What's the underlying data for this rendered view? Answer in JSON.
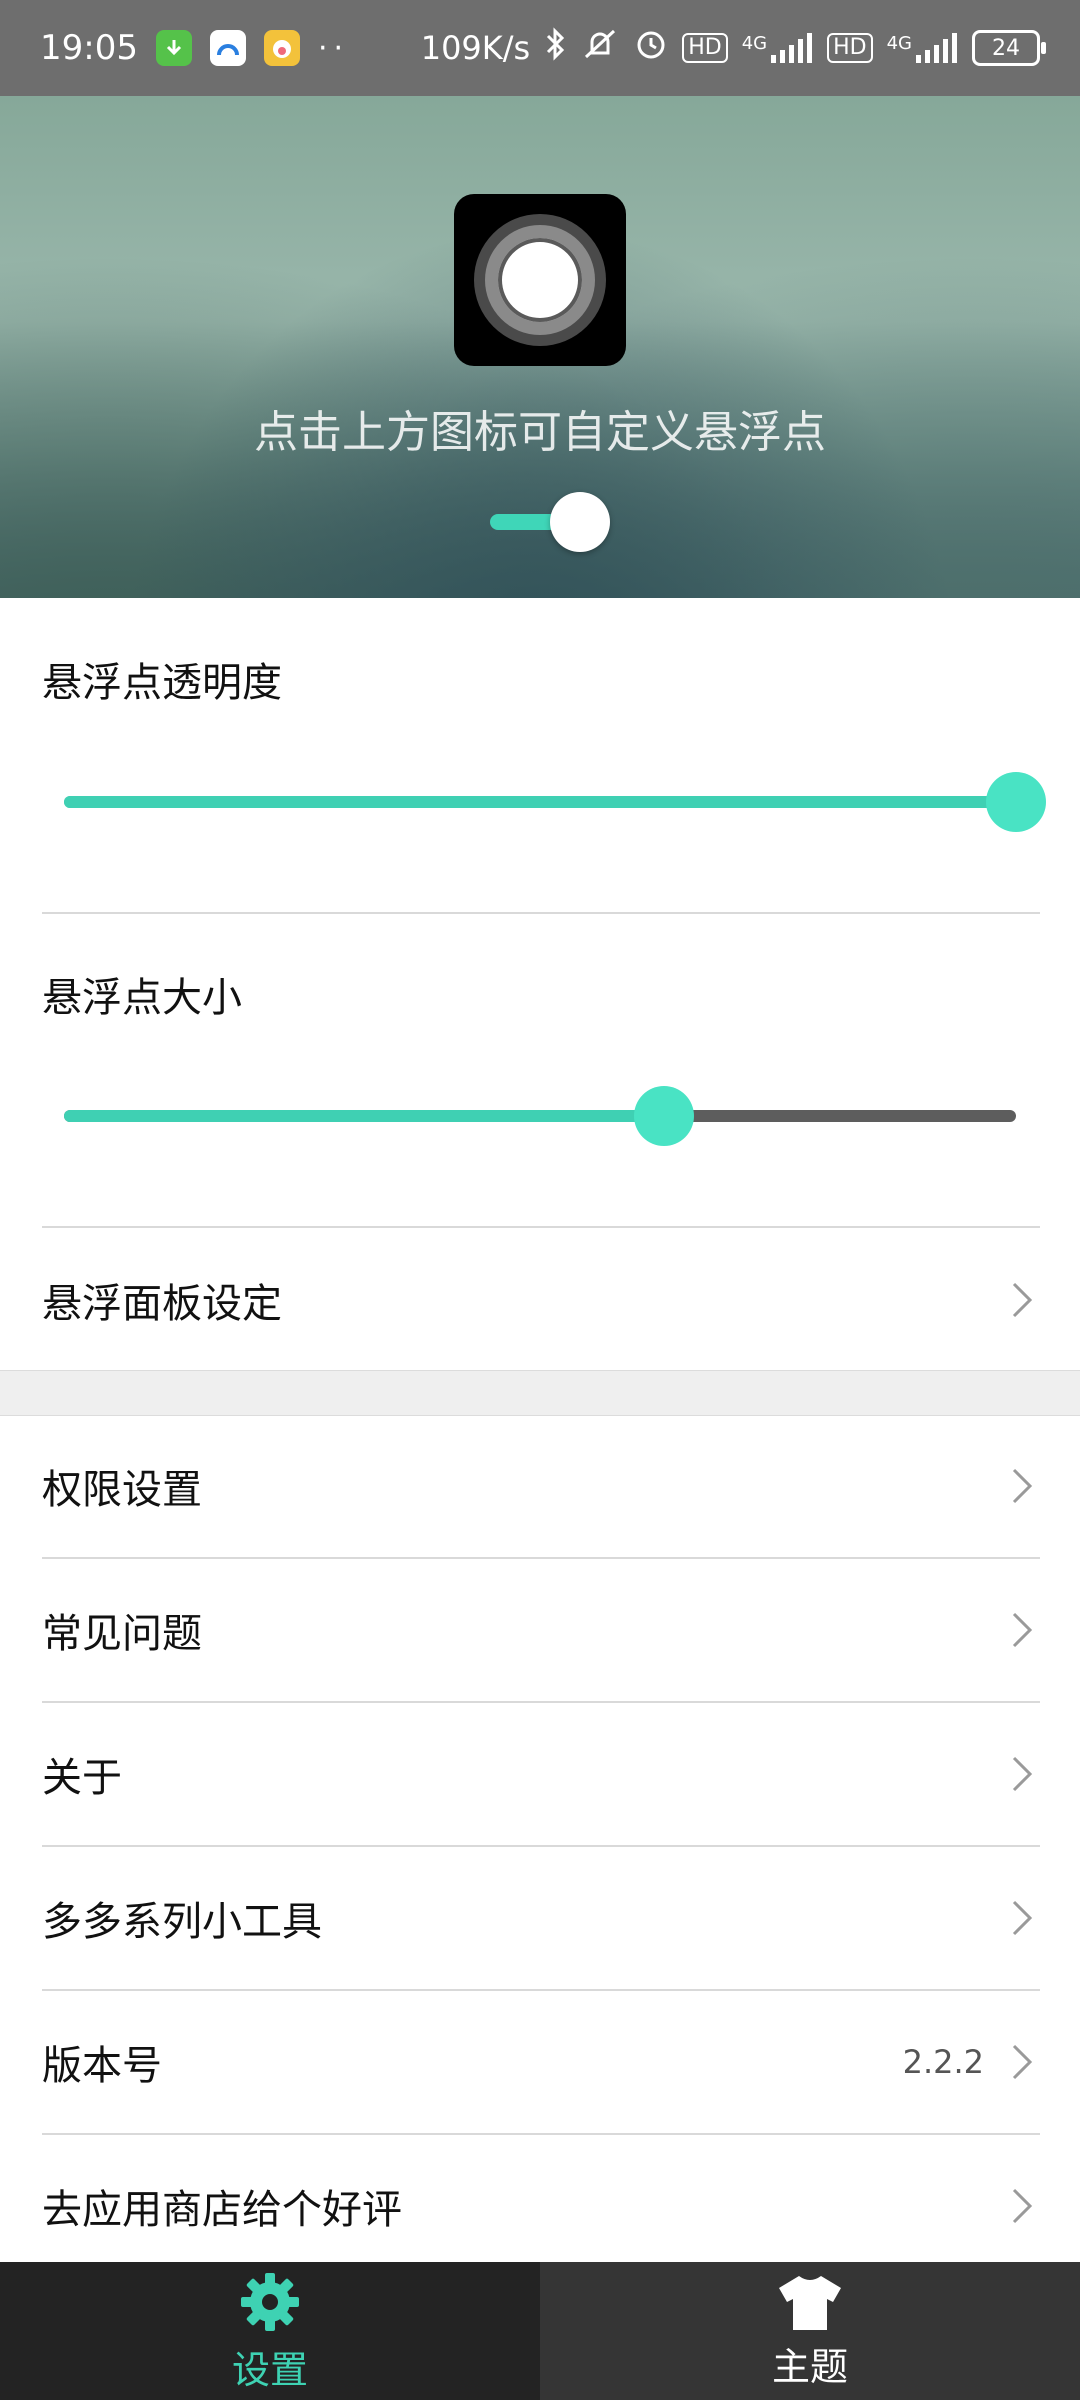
{
  "status_bar": {
    "time": "19:05",
    "dots": "··",
    "net_speed": "109K/s",
    "hd1": "HD",
    "net1": "4G",
    "hd2": "HD",
    "net2": "4G",
    "battery": "24"
  },
  "header": {
    "hint": "点击上方图标可自定义悬浮点",
    "float_toggle_on": true
  },
  "opacity": {
    "title": "悬浮点透明度",
    "value_fraction": 1.0
  },
  "size": {
    "title": "悬浮点大小",
    "value_fraction": 0.63
  },
  "rows": {
    "panel_settings": "悬浮面板设定",
    "permissions": "权限设置",
    "faq": "常见问题",
    "about": "关于",
    "tools": "多多系列小工具",
    "version_label": "版本号",
    "version_value": "2.2.2",
    "rate": "去应用商店给个好评"
  },
  "bottom_nav": {
    "settings": "设置",
    "theme": "主题"
  },
  "colors": {
    "accent": "#3ed2b3",
    "status_bar": "#6e6e6e",
    "nav_active": "#232323",
    "nav_inactive": "#353535"
  }
}
